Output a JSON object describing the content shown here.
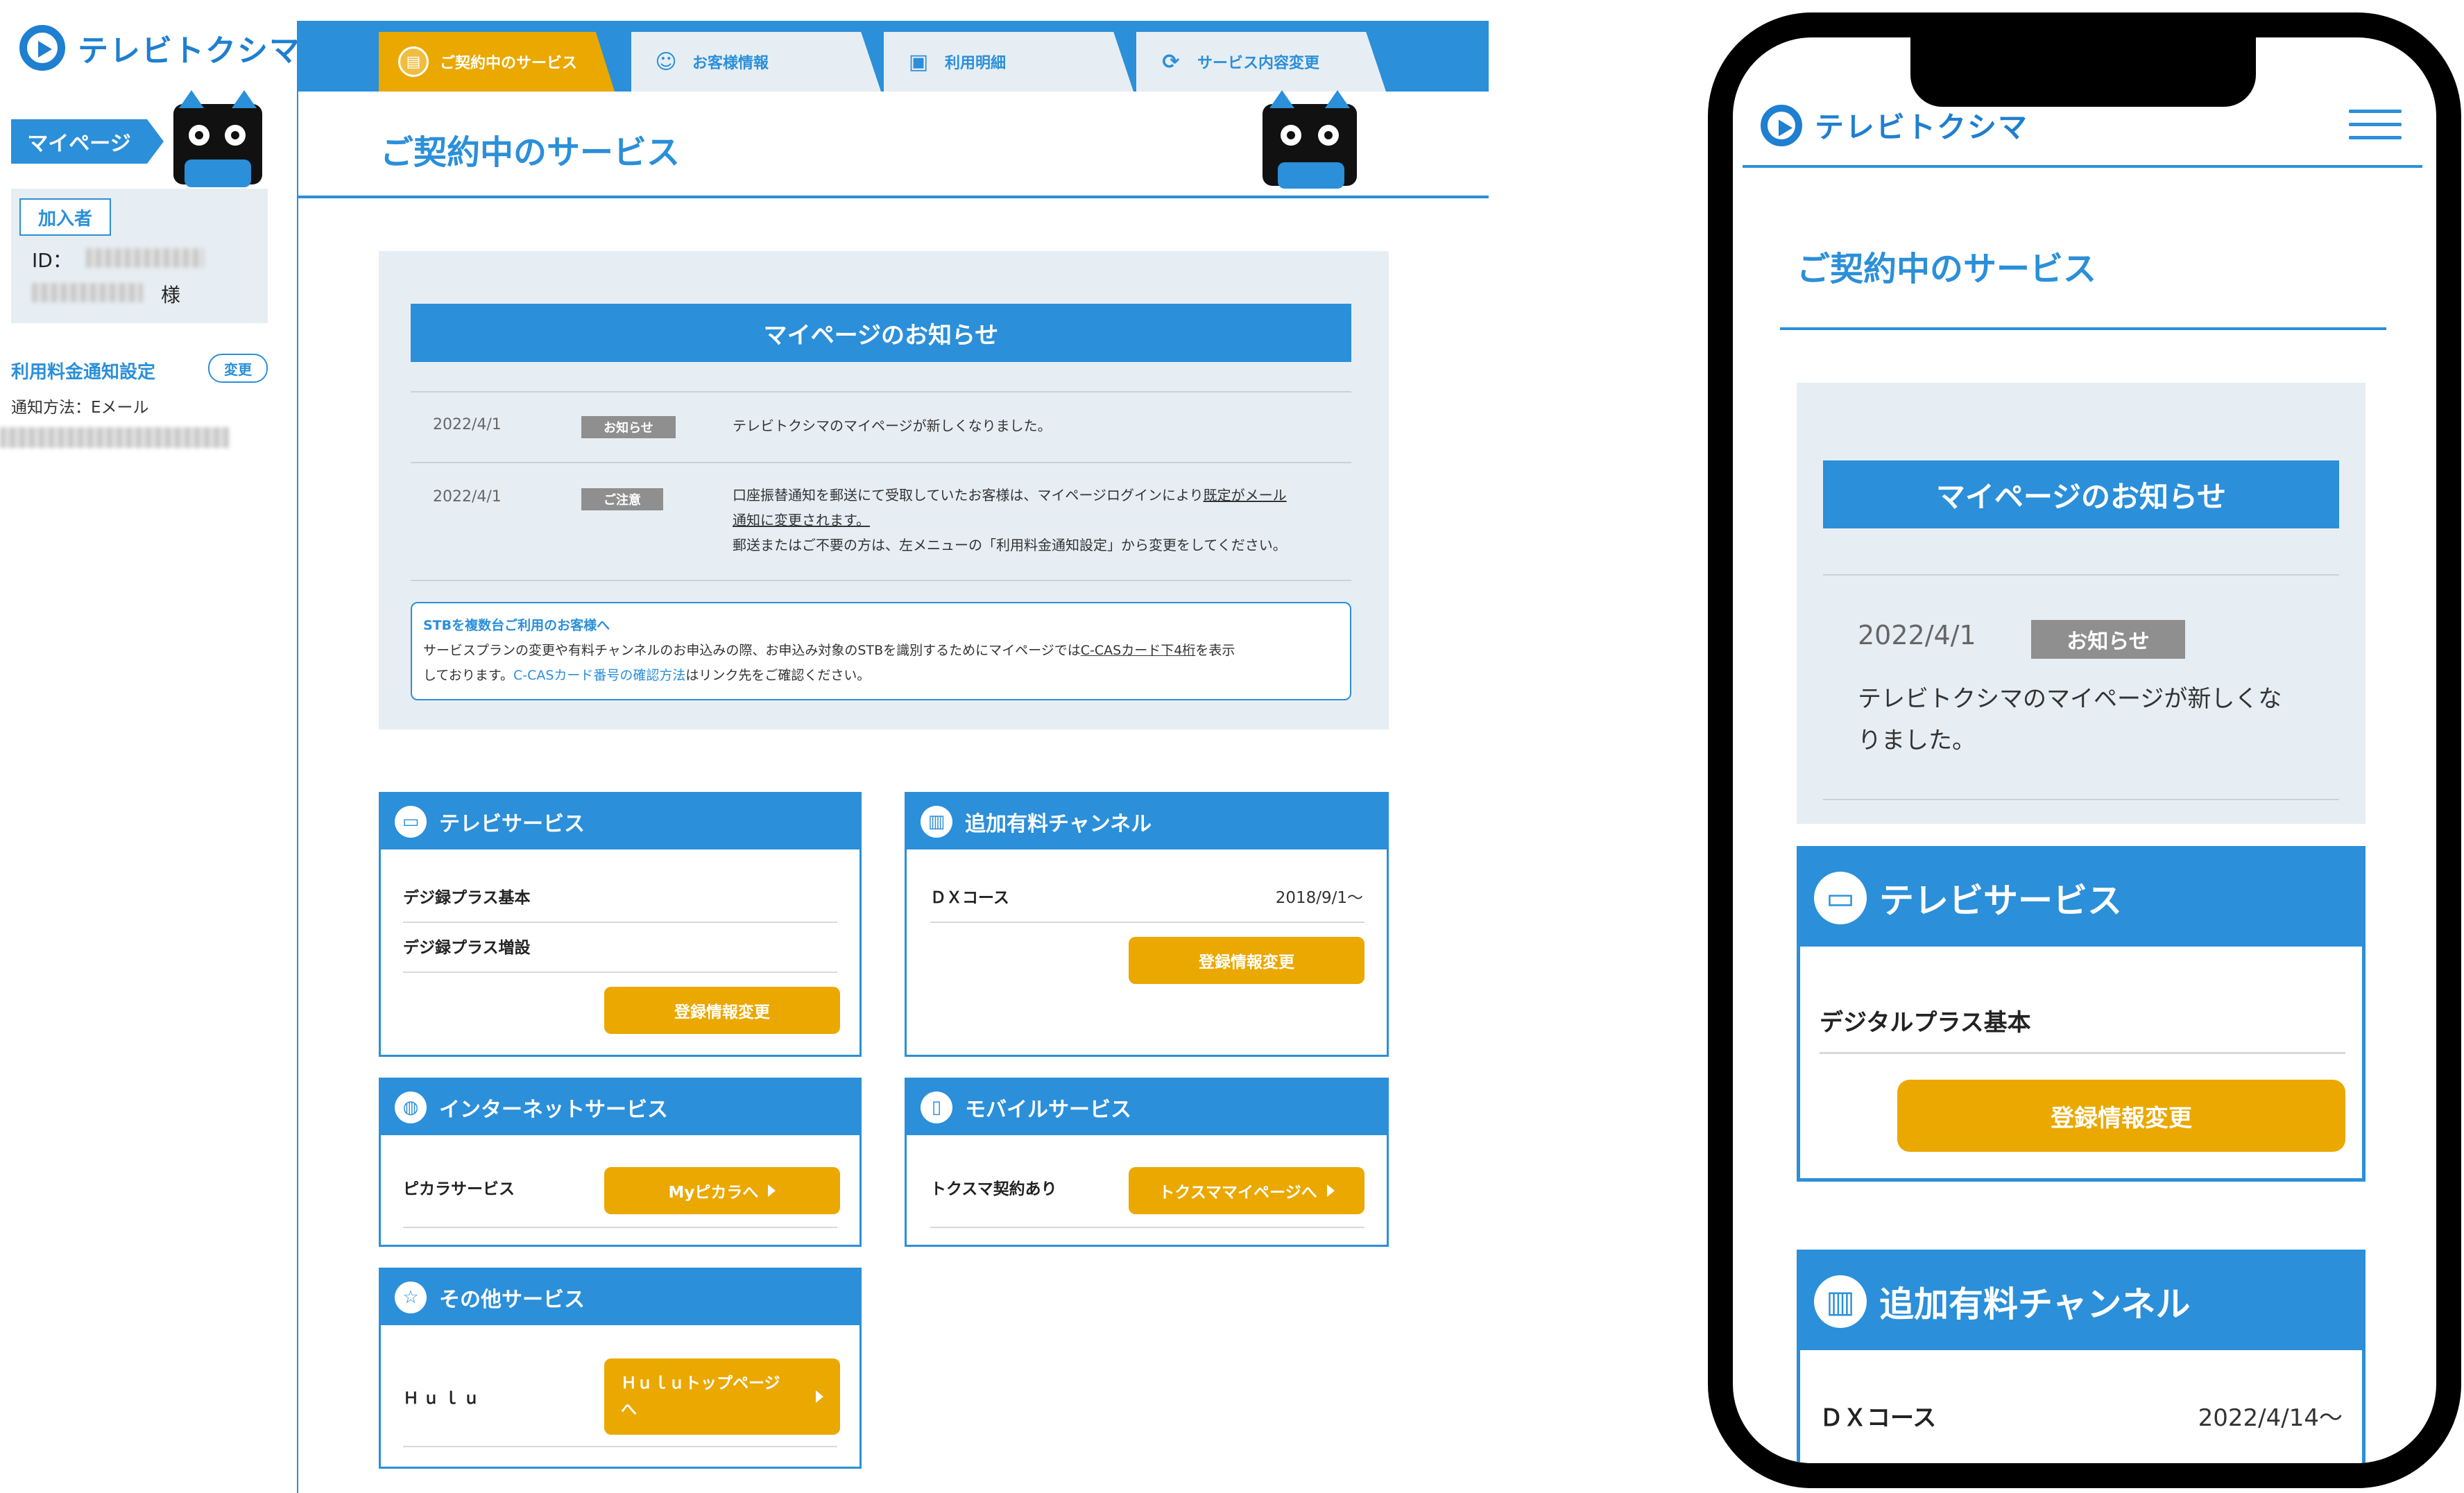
{
  "brand": {
    "name": "テレビトクシマ"
  },
  "sidebar": {
    "mypage_label": "マイページ",
    "member_tag": "加入者",
    "id_label": "ID：",
    "sama": "様",
    "notify_title": "利用料金通知設定",
    "change_label": "変更",
    "notify_method": "通知方法：Eメール"
  },
  "tabs": [
    {
      "label": "ご契約中のサービス",
      "icon": "document-icon"
    },
    {
      "label": "お客様情報",
      "icon": "user-icon"
    },
    {
      "label": "利用明細",
      "icon": "receipt-icon"
    },
    {
      "label": "サービス内容変更",
      "icon": "refresh-icon"
    }
  ],
  "main": {
    "page_title": "ご契約中のサービス",
    "notice": {
      "title": "マイページのお知らせ",
      "items": [
        {
          "date": "2022/4/1",
          "badge": "お知らせ",
          "text": "テレビトクシマのマイページが新しくなりました。"
        },
        {
          "date": "2022/4/1",
          "badge": "ご注意",
          "line1a": "口座振替通知を郵送にて受取していたお客様は、マイページログインにより",
          "line1b": "既定がメール",
          "line2": "通知に変更されます。",
          "line3": "郵送またはご不要の方は、左メニューの「利用料金通知設定」から変更をしてください。"
        }
      ],
      "stb": {
        "title": "STBを複数台ご利用のお客様へ",
        "line1a": "サービスプランの変更や有料チャンネルのお申込みの際、お申込み対象のSTBを識別するためにマイページでは",
        "line1b": "C-CASカード下4桁",
        "line1c": "を表示",
        "line2a": "しております。",
        "line2b": "C-CASカード番号の確認方法",
        "line2c": "はリンク先をご確認ください。"
      }
    },
    "cards": {
      "tv": {
        "title": "テレビサービス",
        "icon": "tv-icon",
        "rows": [
          "デジ録プラス基本",
          "デジ録プラス増設"
        ],
        "button": "登録情報変更"
      },
      "paid": {
        "title": "追加有料チャンネル",
        "icon": "book-icon",
        "row": "ＤＸコース",
        "date": "2018/9/1〜",
        "button": "登録情報変更"
      },
      "net": {
        "title": "インターネットサービス",
        "icon": "globe-icon",
        "row": "ピカラサービス",
        "button": "Myピカラへ"
      },
      "mobile": {
        "title": "モバイルサービス",
        "icon": "mobile-icon",
        "row": "トクスマ契約あり",
        "button": "トクスママイページへ"
      },
      "other": {
        "title": "その他サービス",
        "icon": "star-icon",
        "row": "Ｈｕｌｕ",
        "button_line1": "Ｈｕｌｕトップページ",
        "button_line2": "へ"
      }
    }
  },
  "phone": {
    "page_title": "ご契約中のサービス",
    "notice_title": "マイページのお知らせ",
    "notice_date": "2022/4/1",
    "notice_badge": "お知らせ",
    "notice_line1": "テレビトクシマのマイページが新しくな",
    "notice_line2": "りました。",
    "tv_title": "テレビサービス",
    "tv_row": "デジタルプラス基本",
    "tv_button": "登録情報変更",
    "paid_title": "追加有料チャンネル",
    "paid_row": "ＤＸコース",
    "paid_date": "2022/4/14〜"
  },
  "colors": {
    "primary": "#2b8fd9",
    "accent": "#eaa800",
    "panel": "#e6eef3",
    "badge": "#8f8f8f"
  }
}
